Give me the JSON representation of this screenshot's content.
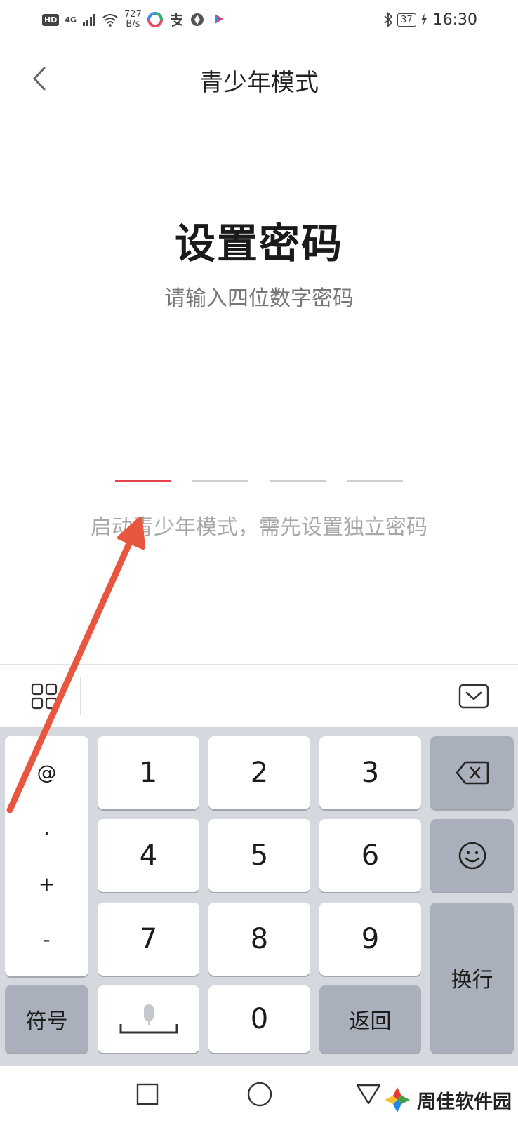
{
  "status_bar": {
    "hd": "HD",
    "network": "4G",
    "speed_value": "727",
    "speed_unit": "B/s",
    "battery": "37",
    "time": "16:30",
    "icons": [
      "signal-icon",
      "wifi-icon",
      "app-icon",
      "alipay-icon",
      "app-icon",
      "youku-icon",
      "bluetooth-icon",
      "charging-icon"
    ]
  },
  "header": {
    "title": "青少年模式",
    "back_icon": "chevron-left-icon"
  },
  "main": {
    "title": "设置密码",
    "subtitle": "请输入四位数字密码",
    "pin_length": 4,
    "pin_filled": 0,
    "hint": "启动青少年模式，需先设置独立密码"
  },
  "colors": {
    "accent": "#e4414f",
    "keyboard_bg": "#d5d8de",
    "dark_key": "#a9b0bb",
    "annotation_arrow": "#e8563f"
  },
  "keyboard": {
    "symbols": [
      "@",
      ".",
      "+",
      "-"
    ],
    "digits": [
      "1",
      "2",
      "3",
      "4",
      "5",
      "6",
      "7",
      "8",
      "9",
      "0"
    ],
    "symbol_key": "符号",
    "back_key": "返回",
    "enter_key": "换行",
    "backspace_icon": "backspace-icon",
    "emoji_icon": "emoji-icon",
    "mic_icon": "microphone-icon",
    "toolbar_left_icon": "grid-icon",
    "toolbar_right_icon": "keyboard-hide-icon"
  },
  "nav_bar": {
    "icons": [
      "recent-apps-icon",
      "home-icon",
      "back-icon"
    ]
  },
  "watermark": {
    "text": "周佳软件园"
  }
}
